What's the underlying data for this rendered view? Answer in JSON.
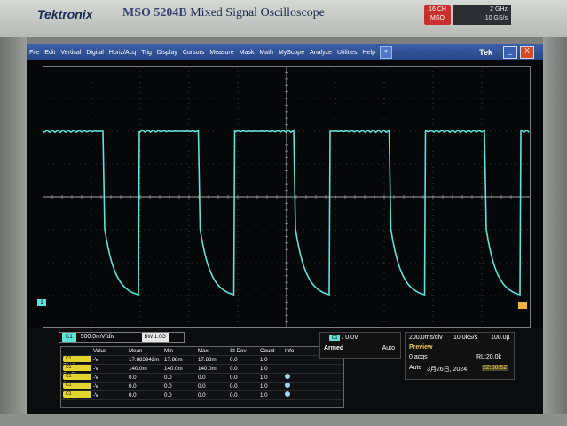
{
  "bezel": {
    "brand": "Tektronix",
    "model": "MSO 5204B",
    "subtitle": "Mixed Signal Oscilloscope",
    "badge_line1": "16 CH",
    "badge_line2": "MSO",
    "spec_line1": "2 GHz",
    "spec_line2": "10 GS/s"
  },
  "menu": {
    "items": [
      "File",
      "Edit",
      "Vertical",
      "Digital",
      "Horiz/Acq",
      "Trig",
      "Display",
      "Cursors",
      "Measure",
      "Mask",
      "Math",
      "MyScope",
      "Analyze",
      "Utilities",
      "Help"
    ],
    "brand": "Tek",
    "min_label": "_",
    "close_label": "X"
  },
  "waveform": {
    "channel_color": "#5fe3d6",
    "high_level": "flat top",
    "cycles": 5
  },
  "markers": {
    "ch1_label": "1"
  },
  "channel": {
    "badge": "C1",
    "scale": "500.0mV/div",
    "bandwidth": "BW 1.0G"
  },
  "measurements": {
    "headers": [
      "Value",
      "Mean",
      "Min",
      "Max",
      "St Dev",
      "Count",
      "Info"
    ],
    "rows": [
      {
        "src": "C1",
        "name": "RMS",
        "value": "-V",
        "mean": "17.883942m",
        "min": "17.88m",
        "max": "17.88m",
        "stdev": "0.0",
        "count": "1.0",
        "info": ""
      },
      {
        "src": "C1",
        "name": "Pk-Pk",
        "value": "-V",
        "mean": "140.0m",
        "min": "140.0m",
        "max": "140.0m",
        "stdev": "0.0",
        "count": "1.0",
        "info": ""
      },
      {
        "src": "C1",
        "name": "Ampl",
        "value": "-V",
        "mean": "0.0",
        "min": "0.0",
        "max": "0.0",
        "stdev": "0.0",
        "count": "1.0",
        "info": "dot"
      },
      {
        "src": "C1",
        "name": "Max",
        "value": "-V",
        "mean": "0.0",
        "min": "0.0",
        "max": "0.0",
        "stdev": "0.0",
        "count": "1.0",
        "info": "dot"
      },
      {
        "src": "C1",
        "name": "Min*",
        "value": "-V",
        "mean": "0.0",
        "min": "0.0",
        "max": "0.0",
        "stdev": "0.0",
        "count": "1.0",
        "info": "dot"
      }
    ]
  },
  "trigger": {
    "badge": "C1",
    "level": "0.0V",
    "state": "Armed",
    "mode": "Auto"
  },
  "acquisition": {
    "horizontal_scale": "200.0ms/div",
    "sample_rate": "10.0kS/s",
    "resolution": "100.0µ",
    "status": "Preview",
    "acqs": "0 acqs",
    "record_length": "RL:20.0k",
    "mode": "Auto",
    "date": "3月26日, 2024",
    "time": "22:08:52"
  }
}
